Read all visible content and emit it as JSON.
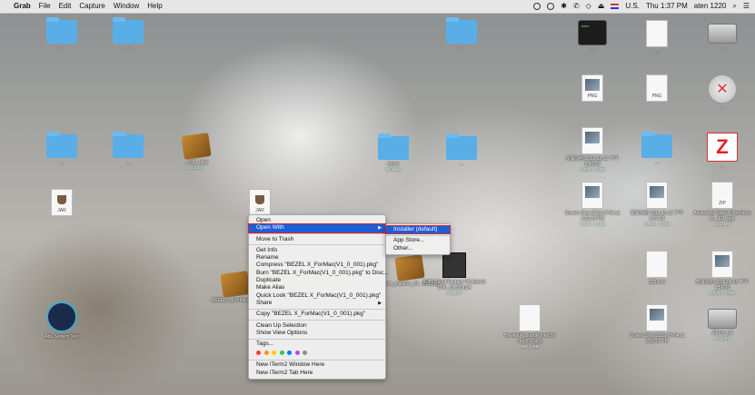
{
  "menubar": {
    "app_name": "Grab",
    "menus": [
      "File",
      "Edit",
      "Capture",
      "Window",
      "Help"
    ],
    "input_source": "U.S.",
    "clock": "Thu 1:37 PM",
    "user": "aten 1220"
  },
  "desktop_icons": [
    {
      "label": "...",
      "kind": "folder"
    },
    {
      "label": "…",
      "kind": "folder"
    },
    {
      "label": "…",
      "kind": "folder"
    },
    {
      "label": "…",
      "kind": "terminal"
    },
    {
      "label": "…",
      "kind": "doc"
    },
    {
      "label": "…",
      "kind": "drive"
    },
    {
      "label": "PNG",
      "kind": "png"
    },
    {
      "label": "PNG",
      "kind": "doc"
    },
    {
      "label": "…",
      "kind": "installer"
    },
    {
      "label": "…",
      "kind": "folder"
    },
    {
      "label": "…",
      "kind": "folder"
    },
    {
      "label": "...V1.1 .pkg",
      "sub": "223 KB",
      "kind": "package"
    },
    {
      "label": "move",
      "sub": "24 items",
      "kind": "folder"
    },
    {
      "label": "…",
      "kind": "folder"
    },
    {
      "label": "螢幕快照 2019-11-12 下午 5.40.02",
      "sub": "1,920 × 1,080",
      "kind": "png"
    },
    {
      "label": "…",
      "kind": "folder"
    },
    {
      "label": "…",
      "kind": "zterm"
    },
    {
      "label": "JAR",
      "kind": "jar"
    },
    {
      "label": "JAR",
      "kind": "jar"
    },
    {
      "label": "Screen Shot 2019-07-04 at 1.35.24 PM",
      "sub": "1,920 × 1,080",
      "kind": "png"
    },
    {
      "label": "螢幕快照 2018-11-12 下午 4.37.26",
      "sub": "1,920 × 1,080",
      "kind": "png"
    },
    {
      "label": "Assassin's Creed Chronicles C... EX .app",
      "sub": "32.2 MB",
      "kind": "zip"
    },
    {
      "label": "BEZEL X_ForMac(V1...",
      "kind": "package"
    },
    {
      "label": "...21A_installer_V1 ..101.png",
      "kind": "png"
    },
    {
      "label": "[GTS] Final Fantasy VII Advent Chil...12-18.mp4",
      "sub": "02:06:27",
      "kind": "video"
    },
    {
      "label": "123.mcr",
      "kind": "doc"
    },
    {
      "label": "螢幕快照 2019-04-16 下午 1.56.10",
      "sub": "1,920 × 1,080",
      "kind": "png"
    },
    {
      "label": "Ada System Test",
      "kind": "gauge"
    },
    {
      "label": "HewlettPackardPrinterDri vers5.1.dmg",
      "sub": "800.1 MB",
      "kind": "doc"
    },
    {
      "label": "Screen Shot 2019-07-04 at 1.30.21 PM",
      "kind": "png"
    },
    {
      "label": "ZTerm 1.2",
      "sub": "10.3 MB",
      "kind": "drive"
    }
  ],
  "context_menu": {
    "items": [
      {
        "label": "Open"
      },
      {
        "label": "Open With",
        "submenu": true,
        "highlighted": true
      },
      {
        "sep": true
      },
      {
        "label": "Move to Trash"
      },
      {
        "sep": true
      },
      {
        "label": "Get Info"
      },
      {
        "label": "Rename"
      },
      {
        "label": "Compress \"BEZEL X_ForMac(V1_0_001).pkg\""
      },
      {
        "label": "Burn \"BEZEL X_ForMac(V1_0_001).pkg\" to Disc..."
      },
      {
        "label": "Duplicate"
      },
      {
        "label": "Make Alias"
      },
      {
        "label": "Quick Look \"BEZEL X_ForMac(V1_0_001).pkg\""
      },
      {
        "label": "Share",
        "submenu": true
      },
      {
        "sep": true
      },
      {
        "label": "Copy \"BEZEL X_ForMac(V1_0_001).pkg\""
      },
      {
        "sep": true
      },
      {
        "label": "Clean Up Selection"
      },
      {
        "label": "Show View Options"
      },
      {
        "sep": true
      },
      {
        "label": "Tags..."
      },
      {
        "tags": true
      },
      {
        "sep": true
      },
      {
        "label": "New iTerm2 Window Here"
      },
      {
        "label": "New iTerm2 Tab Here"
      }
    ],
    "tag_colors": [
      "#ff3b30",
      "#ff9500",
      "#ffcc00",
      "#34c759",
      "#007aff",
      "#af52de",
      "#8e8e93"
    ]
  },
  "open_with_submenu": {
    "items": [
      {
        "label": "Installer (default)",
        "highlighted": true
      },
      {
        "sep": true
      },
      {
        "label": "App Store..."
      },
      {
        "label": "Other..."
      }
    ]
  },
  "colors": {
    "selection": "#1d5fd9",
    "highlight_outline": "#e02020"
  }
}
